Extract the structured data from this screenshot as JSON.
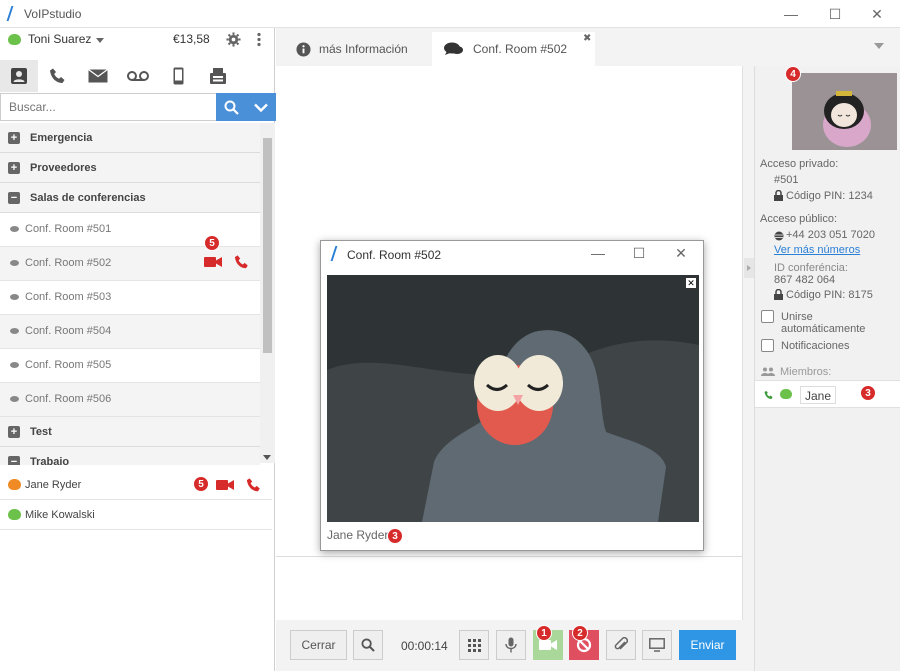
{
  "window": {
    "title": "VoIPstudio",
    "minimize": "—",
    "maximize": "☐",
    "close": "✕"
  },
  "user": {
    "name": "Toni Suarez",
    "credit": "€13,58"
  },
  "search": {
    "placeholder": "Buscar..."
  },
  "groups": [
    {
      "label": "Emergencia",
      "sign": "+"
    },
    {
      "label": "Proveedores",
      "sign": "+"
    },
    {
      "label": "Salas de conferencias",
      "sign": "−"
    },
    {
      "label": "Test",
      "sign": "+"
    },
    {
      "label": "Trabajo",
      "sign": "−"
    }
  ],
  "rooms": [
    "Conf. Room #501",
    "Conf. Room #502",
    "Conf. Room #503",
    "Conf. Room #504",
    "Conf. Room #505",
    "Conf. Room #506"
  ],
  "contacts": [
    {
      "name": "Jane Ryder",
      "status_color": "#f08a24"
    },
    {
      "name": "Mike Kowalski",
      "status_color": "#6cc14a"
    }
  ],
  "badges": {
    "b1": "1",
    "b2": "2",
    "b3": "3",
    "b4": "4",
    "b5": "5"
  },
  "center_tabs": {
    "info": "más Información",
    "room": "Conf. Room #502",
    "close": "✖"
  },
  "bottom": {
    "close": "Cerrar",
    "timer": "00:00:14",
    "send": "Enviar"
  },
  "right": {
    "private_access": "Acceso privado:",
    "private_number": "#501",
    "private_pin": "Código PIN: 1234",
    "public_access": "Acceso público:",
    "public_number": "+44 203 051 7020",
    "more_numbers": "Ver más números",
    "conf_id_label": "ID conferéncia:",
    "conf_id": "867 482 064",
    "public_pin": "Código PIN: 8175",
    "auto_join": "Unirse automáticamente",
    "notifications": "Notificaciones",
    "members": "Miembros:",
    "member_name": "Jane"
  },
  "popup": {
    "title": "Conf. Room #502",
    "caption": "Jane Ryder",
    "close_video": "✕"
  },
  "colors": {
    "accent": "#4a90d9",
    "danger": "#d72a2a",
    "online": "#6cc14a",
    "away": "#f08a24",
    "video_on": "#a9d89a",
    "blocked": "#e04f5f"
  }
}
